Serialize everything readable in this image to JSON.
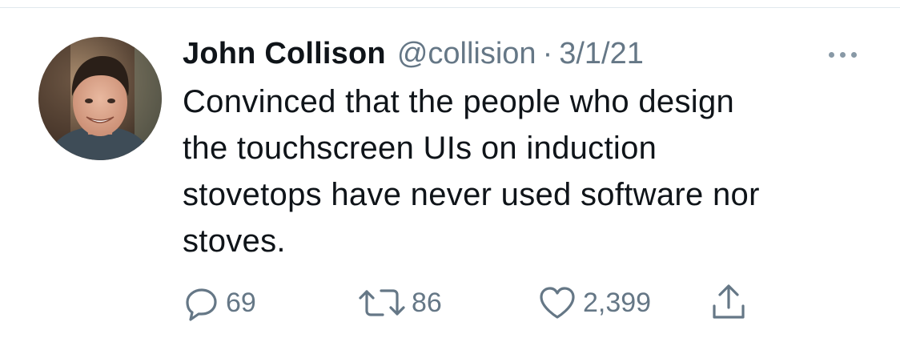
{
  "tweet": {
    "author": {
      "display_name": "John Collison",
      "handle": "@collision",
      "separator": "·",
      "date": "3/1/21"
    },
    "text": "Convinced that the people who design\nthe touchscreen UIs on induction\nstovetops have never used software nor\nstoves.",
    "actions": {
      "replies": "69",
      "retweets": "86",
      "likes": "2,399"
    }
  },
  "icons": {
    "more": "more-icon",
    "reply": "reply-icon",
    "retweet": "retweet-icon",
    "like": "heart-icon",
    "share": "share-icon"
  },
  "colors": {
    "text_primary": "#0f1419",
    "text_secondary": "#657786",
    "divider": "#e1e8ed"
  }
}
